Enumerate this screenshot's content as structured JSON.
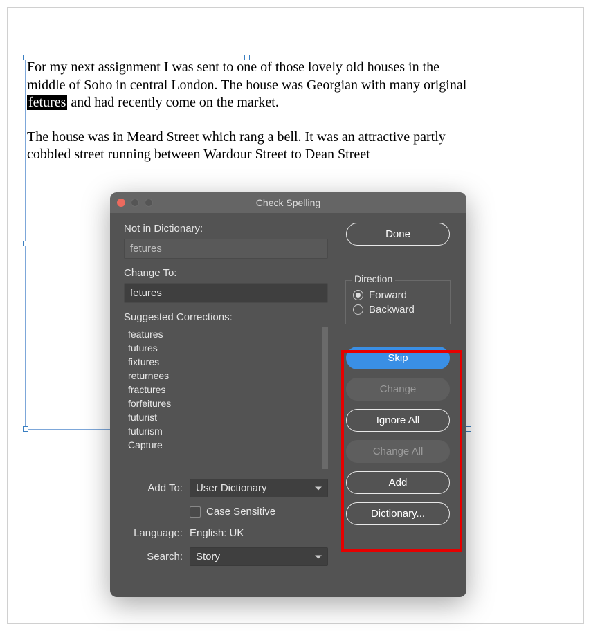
{
  "document": {
    "paragraph1_before": "For my next assignment I was sent to one of those lovely old houses in the middle of Soho in central London. The house was Georgian with many original ",
    "misspelled": "fetures",
    "paragraph1_after": " and had recently come on the market.",
    "paragraph2": "The house was in Meard Street which rang a bell. It was an attractive partly cobbled street running between Wardour Street to Dean Street"
  },
  "dialog": {
    "title": "Check Spelling",
    "not_in_dict_label": "Not in Dictionary:",
    "not_in_dict_value": "fetures",
    "change_to_label": "Change To:",
    "change_to_value": "fetures",
    "suggestions_label": "Suggested Corrections:",
    "suggestions": [
      "features",
      "futures",
      "fixtures",
      "returnees",
      "fractures",
      "forfeitures",
      "futurist",
      "futurism",
      "Capture"
    ],
    "add_to_label": "Add To:",
    "add_to_value": "User Dictionary",
    "case_sensitive_label": "Case Sensitive",
    "language_label": "Language:",
    "language_value": "English: UK",
    "search_label": "Search:",
    "search_value": "Story",
    "direction_label": "Direction",
    "direction_forward": "Forward",
    "direction_backward": "Backward",
    "buttons": {
      "done": "Done",
      "skip": "Skip",
      "change": "Change",
      "ignore_all": "Ignore All",
      "change_all": "Change All",
      "add": "Add",
      "dictionary": "Dictionary..."
    }
  }
}
